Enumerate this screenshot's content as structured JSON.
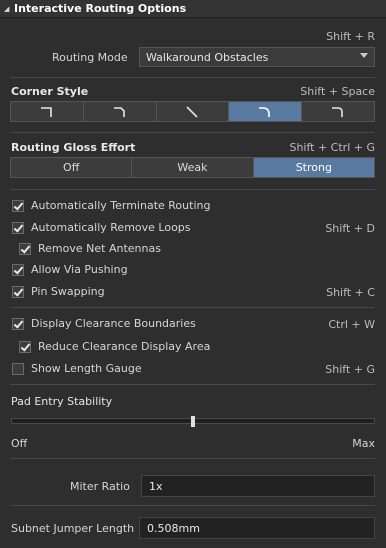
{
  "header": {
    "title": "Interactive Routing Options"
  },
  "routing_mode": {
    "shortcut": "Shift + R",
    "label": "Routing Mode",
    "value": "Walkaround Obstacles"
  },
  "corner_style": {
    "title": "Corner Style",
    "shortcut": "Shift + Space",
    "options": [
      "corner-90-icon",
      "corner-45-small-icon",
      "diagonal-line-icon",
      "corner-arc-icon",
      "corner-arc-small-icon"
    ],
    "selected_index": 3
  },
  "gloss": {
    "title": "Routing Gloss Effort",
    "shortcut": "Shift + Ctrl + G",
    "options": [
      "Off",
      "Weak",
      "Strong"
    ],
    "selected": "Strong"
  },
  "checks": [
    {
      "label": "Automatically Terminate Routing",
      "checked": true,
      "shortcut": ""
    },
    {
      "label": "Automatically Remove Loops",
      "checked": true,
      "shortcut": "Shift + D"
    },
    {
      "label": "Remove Net Antennas",
      "checked": true,
      "shortcut": ""
    },
    {
      "label": "Allow Via Pushing",
      "checked": true,
      "shortcut": ""
    },
    {
      "label": "Pin Swapping",
      "checked": true,
      "shortcut": "Shift + C"
    },
    {
      "label": "Display Clearance Boundaries",
      "checked": true,
      "shortcut": "Ctrl + W"
    },
    {
      "label": "Reduce Clearance Display Area",
      "checked": true,
      "shortcut": ""
    },
    {
      "label": "Show Length Gauge",
      "checked": false,
      "shortcut": "Shift + G"
    }
  ],
  "pad_entry": {
    "title": "Pad Entry Stability",
    "min_label": "Off",
    "max_label": "Max",
    "value_fraction": 0.5
  },
  "miter_ratio": {
    "label": "Miter Ratio",
    "value": "1x"
  },
  "subnet_jumper": {
    "label": "Subnet Jumper Length",
    "value": "0.508mm"
  },
  "colors": {
    "accent": "#587aa0",
    "background": "#2e2e2e"
  }
}
